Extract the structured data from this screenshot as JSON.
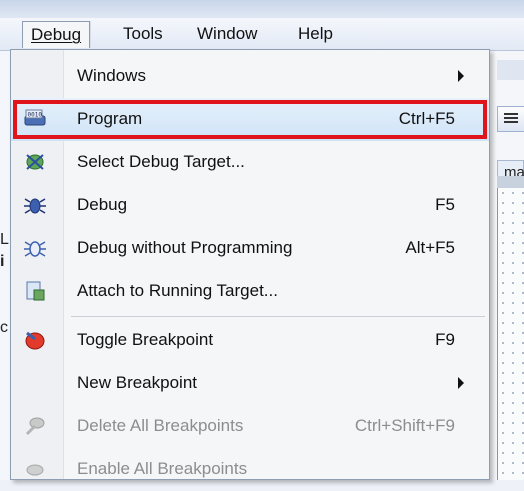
{
  "menubar": {
    "items": [
      {
        "label": "Debug",
        "open": true
      },
      {
        "label": "Tools"
      },
      {
        "label": "Window"
      },
      {
        "label": "Help"
      }
    ]
  },
  "background": {
    "left_chars": [
      "L",
      "i",
      "c"
    ],
    "tab_stub_text": "ma"
  },
  "menu": {
    "items": [
      {
        "label": "Windows",
        "shortcut": "",
        "submenu": true,
        "icon": "none"
      },
      {
        "label": "Program",
        "shortcut": "Ctrl+F5",
        "highlighted": true,
        "icon": "program-chip-icon"
      },
      {
        "label": "Select Debug Target...",
        "shortcut": "",
        "icon": "select-target-icon"
      },
      {
        "label": "Debug",
        "shortcut": "F5",
        "icon": "bug-icon"
      },
      {
        "label": "Debug without Programming",
        "shortcut": "Alt+F5",
        "icon": "bug-outline-icon"
      },
      {
        "label": "Attach to Running Target...",
        "shortcut": "",
        "icon": "attach-icon"
      },
      {
        "label": "Toggle Breakpoint",
        "shortcut": "F9",
        "icon": "breakpoint-icon"
      },
      {
        "label": "New Breakpoint",
        "shortcut": "",
        "submenu": true,
        "icon": "none"
      },
      {
        "label": "Delete All Breakpoints",
        "shortcut": "Ctrl+Shift+F9",
        "disabled": true,
        "icon": "delete-breakpoints-icon"
      },
      {
        "label": "Enable All Breakpoints",
        "shortcut": "",
        "disabled": true,
        "icon": "enable-breakpoints-icon"
      }
    ]
  },
  "colors": {
    "highlight_border": "#e0141b",
    "highlight_fill": "#cfe3f7"
  }
}
